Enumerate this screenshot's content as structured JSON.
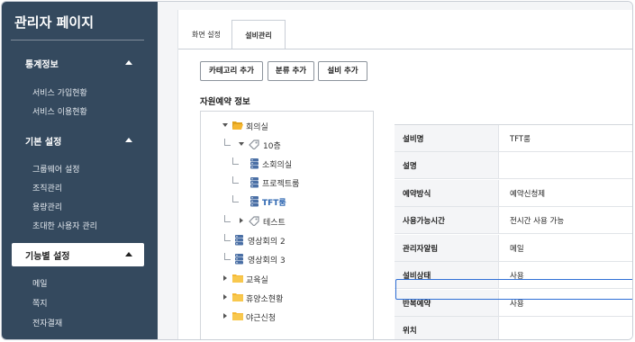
{
  "sidebar": {
    "title": "관리자 페이지",
    "sections": [
      {
        "label": "통계정보",
        "items": [
          "서비스 가입현황",
          "서비스 이용현황"
        ]
      },
      {
        "label": "기본 설정",
        "items": [
          "그룹웨어 설정",
          "조직관리",
          "용량관리",
          "초대한 사용자 관리"
        ]
      },
      {
        "label": "기능별 설정",
        "items": [
          "메일",
          "쪽지",
          "전자결재"
        ]
      }
    ]
  },
  "tabs": [
    "화면 설정",
    "설비관리"
  ],
  "active_tab": "설비관리",
  "buttons": {
    "add_category": "카테고리 추가",
    "add_class": "분류 추가",
    "add_equipment": "설비 추가"
  },
  "section_title": "자원예약 정보",
  "tree": {
    "meeting_room": "회의실",
    "floor10": "10층",
    "small_room": "소회의실",
    "project_room": "프로젝트룸",
    "tft_room": "TFT룸",
    "test": "테스트",
    "video2": "영상회의 2",
    "video3": "영상회의 3",
    "training_room": "교육실",
    "lounge": "휴양소현황",
    "overtime": "야근신청"
  },
  "details": [
    {
      "label": "설비명",
      "value": "TFT룸"
    },
    {
      "label": "설명",
      "value": ""
    },
    {
      "label": "예약방식",
      "value": "예약신청제"
    },
    {
      "label": "사용가능시간",
      "value": "전시간 사용 가능"
    },
    {
      "label": "관리자알림",
      "value": "메일"
    },
    {
      "label": "설비상태",
      "value": "사용"
    },
    {
      "label": "반복예약",
      "value": "사용"
    },
    {
      "label": "위치",
      "value": ""
    }
  ],
  "colors": {
    "sidebar": "#34495e",
    "accent": "#2f6fd6",
    "folder": "#f5b731",
    "selected_text": "#2e67b1"
  }
}
